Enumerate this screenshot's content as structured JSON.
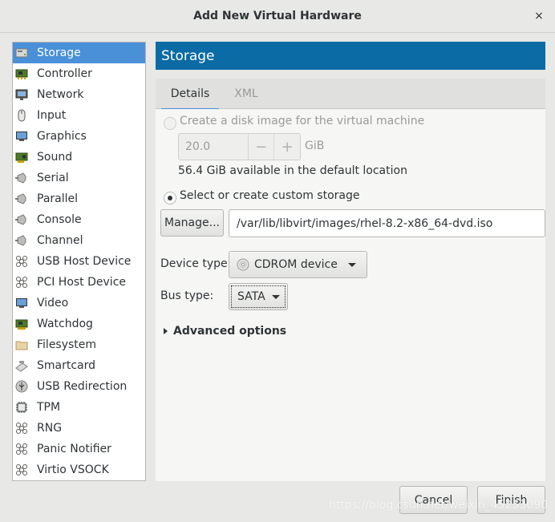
{
  "window": {
    "title": "Add New Virtual Hardware",
    "close_glyph": "×"
  },
  "sidebar": {
    "items": [
      {
        "label": "Storage",
        "icon": "storage-icon",
        "selected": true
      },
      {
        "label": "Controller",
        "icon": "controller-icon"
      },
      {
        "label": "Network",
        "icon": "network-icon"
      },
      {
        "label": "Input",
        "icon": "mouse-icon"
      },
      {
        "label": "Graphics",
        "icon": "monitor-icon"
      },
      {
        "label": "Sound",
        "icon": "sound-card-icon"
      },
      {
        "label": "Serial",
        "icon": "serial-plug-icon"
      },
      {
        "label": "Parallel",
        "icon": "parallel-plug-icon"
      },
      {
        "label": "Console",
        "icon": "console-plug-icon"
      },
      {
        "label": "Channel",
        "icon": "channel-plug-icon"
      },
      {
        "label": "USB Host Device",
        "icon": "usb-host-icon"
      },
      {
        "label": "PCI Host Device",
        "icon": "pci-host-icon"
      },
      {
        "label": "Video",
        "icon": "video-monitor-icon"
      },
      {
        "label": "Watchdog",
        "icon": "watchdog-icon"
      },
      {
        "label": "Filesystem",
        "icon": "folder-icon"
      },
      {
        "label": "Smartcard",
        "icon": "smartcard-icon"
      },
      {
        "label": "USB Redirection",
        "icon": "usb-redirection-icon"
      },
      {
        "label": "TPM",
        "icon": "tpm-chip-icon"
      },
      {
        "label": "RNG",
        "icon": "rng-icon"
      },
      {
        "label": "Panic Notifier",
        "icon": "panic-notifier-icon"
      },
      {
        "label": "Virtio VSOCK",
        "icon": "vsock-icon"
      }
    ]
  },
  "main": {
    "header": "Storage",
    "tabs": [
      {
        "label": "Details",
        "active": true
      },
      {
        "label": "XML",
        "active": false
      }
    ],
    "create_disk": {
      "label": "Create a disk image for the virtual machine",
      "checked": false,
      "size_value": "20.0",
      "minus": "−",
      "plus": "+",
      "unit": "GiB",
      "available": "56.4 GiB available in the default location"
    },
    "custom_storage": {
      "label": "Select or create custom storage",
      "checked": true,
      "manage_button": "Manage...",
      "path": "/var/lib/libvirt/images/rhel-8.2-x86_64-dvd.iso"
    },
    "device_type": {
      "label": "Device type:",
      "value": "CDROM device",
      "icon": "cdrom-icon"
    },
    "bus_type": {
      "label": "Bus type:",
      "value": "SATA"
    },
    "advanced": {
      "label": "Advanced options"
    }
  },
  "footer": {
    "cancel": "Cancel",
    "finish": "Finish"
  },
  "watermark": "https://blog.csdn.net/weixin_45253090",
  "colors": {
    "accent": "#4a90d9",
    "header": "#0b6ba5"
  }
}
